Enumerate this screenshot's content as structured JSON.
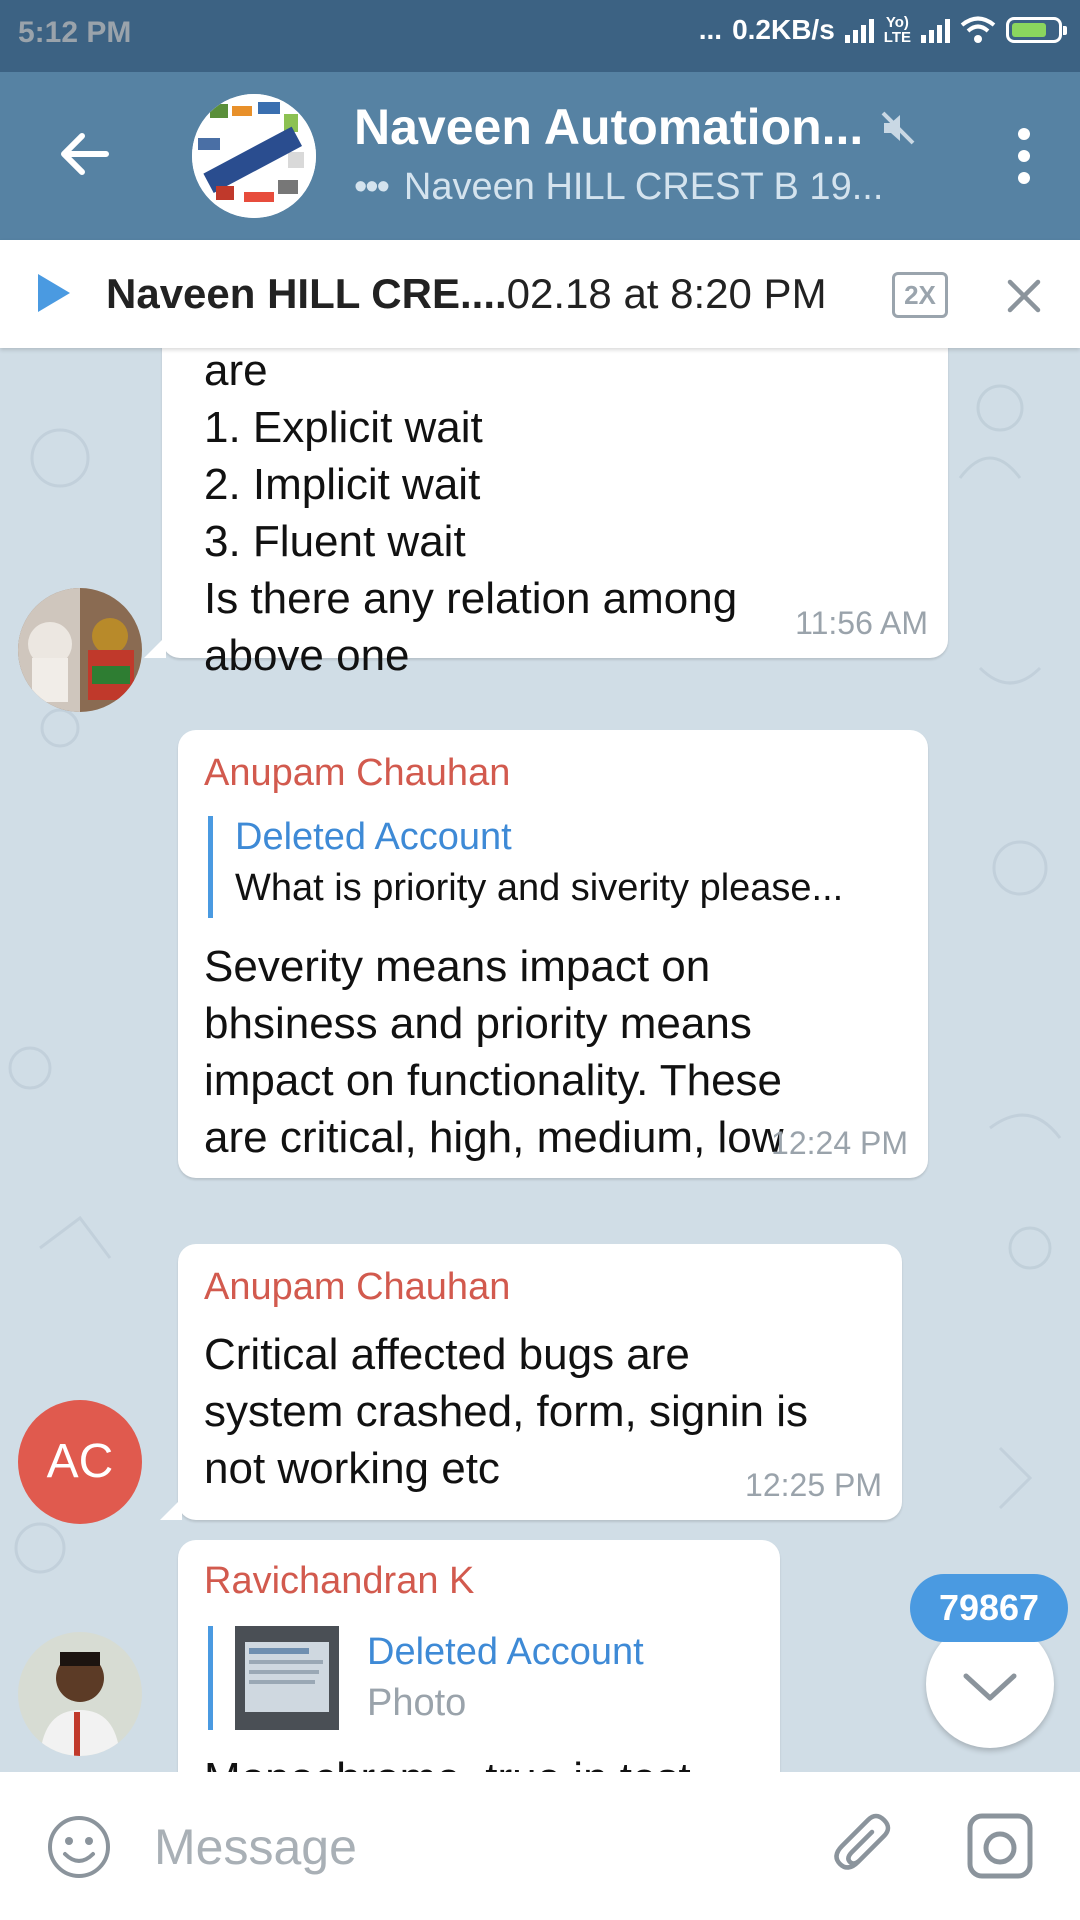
{
  "status_bar": {
    "time": "5:12 PM",
    "dots": "...",
    "speed": "0.2KB/s",
    "lte_top": "Yo)",
    "lte_bottom": "LTE"
  },
  "header": {
    "title": "Naveen Automation...",
    "typing_dots": "•••",
    "subtitle": "Naveen HILL CREST B 19..."
  },
  "player": {
    "title_bold": "Naveen HILL CRE....",
    "title_rest": "02.18 at 8:20 PM",
    "speed": "2X"
  },
  "messages": [
    {
      "lines": [
        "are",
        "1. Explicit wait",
        "2. Implicit wait",
        "3. Fluent wait",
        "Is there any relation among",
        "above one"
      ],
      "time": "11:56 AM"
    },
    {
      "sender": "Anupam Chauhan",
      "reply_name": "Deleted Account",
      "reply_text": "What is priority and siverity please...",
      "lines": [
        "Severity means impact on",
        "bhsiness and priority means",
        "impact on functionality. These",
        "are critical, high, medium, low"
      ],
      "time": "12:24 PM"
    },
    {
      "sender": "Anupam Chauhan",
      "lines": [
        "Critical affected bugs are",
        "system crashed, form, signin is",
        "not working etc"
      ],
      "time": "12:25 PM",
      "avatar_initials": "AC"
    },
    {
      "sender": "Ravichandran K",
      "reply_name": "Deleted Account",
      "reply_text": "Photo",
      "partial_line": "Monochrome_true in test"
    }
  ],
  "unread_count": "79867",
  "input": {
    "placeholder": "Message"
  },
  "colors": {
    "status_bar": "#3c6283",
    "app_bar": "#5682a3",
    "accent": "#4a9ae1",
    "sender_name": "#d25a4e",
    "chat_bg": "#d0dde6"
  }
}
